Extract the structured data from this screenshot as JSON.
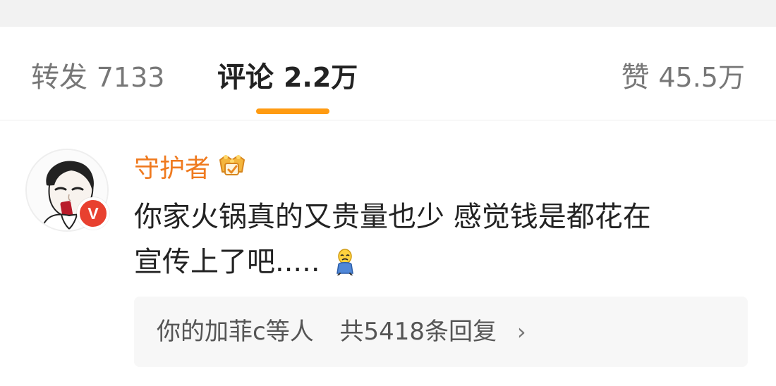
{
  "tabs": {
    "repost": {
      "label": "转发",
      "count": "7133"
    },
    "comments": {
      "label": "评论",
      "count": "2.2万",
      "active": true
    },
    "likes": {
      "label": "赞",
      "count": "45.5万"
    }
  },
  "colors": {
    "accent": "#ff9b12",
    "username": "#ef7a1f",
    "verified": "#e8402f",
    "reply_bg": "#f7f7f7"
  },
  "comment": {
    "avatar_icon": "avatar-icon",
    "verified_badge": "V",
    "username": "守护者",
    "badge_icon": "crown-badge-icon",
    "text_line_1": "你家火锅真的又贵量也少 感觉钱是都花在",
    "text_line_2": "宣传上了吧.....",
    "emoji_icon": "sad-face-emoji-icon",
    "replies": {
      "names": "你的加菲c等人",
      "summary": "共5418条回复",
      "chevron": "›"
    }
  }
}
